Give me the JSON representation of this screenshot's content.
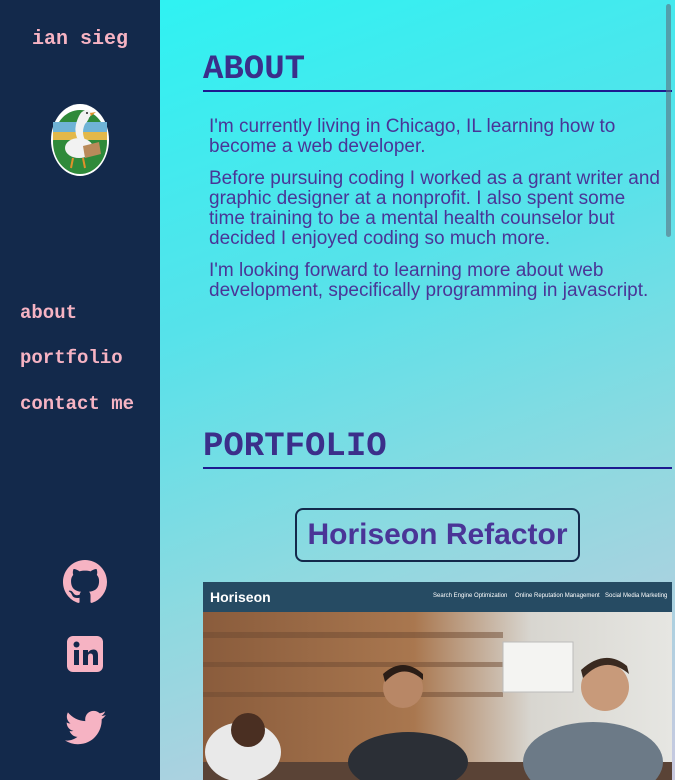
{
  "sidebar": {
    "brand": "ian sieg",
    "nav": [
      {
        "label": "about"
      },
      {
        "label": "portfolio"
      },
      {
        "label": "contact me"
      }
    ],
    "social": [
      "github-icon",
      "linkedin-icon",
      "twitter-icon"
    ]
  },
  "about": {
    "title": "ABOUT",
    "paragraphs": [
      "I'm currently living in Chicago, IL learning how to become a web developer.",
      "Before pursuing coding I worked as a grant writer and graphic designer at a nonprofit. I also spent some time training to be a mental health counselor but decided I enjoyed coding so much more.",
      "I'm looking forward to learning more about web development, specifically programming in javascript."
    ]
  },
  "portfolio": {
    "title": "PORTFOLIO",
    "project": {
      "title": "Horiseon Refactor",
      "preview": {
        "brand": "Horiseon",
        "nav": [
          "Search Engine Optimization",
          "Online Reputation Management",
          "Social Media Marketing"
        ]
      }
    }
  },
  "colors": {
    "sidebar_bg": "#13294b",
    "accent_pink": "#f6b3c3",
    "heading_purple": "#3b2f8a",
    "text_purple": "#4a3597",
    "gradient_start": "#2ff2f2",
    "gradient_end": "#c9c9e0"
  }
}
